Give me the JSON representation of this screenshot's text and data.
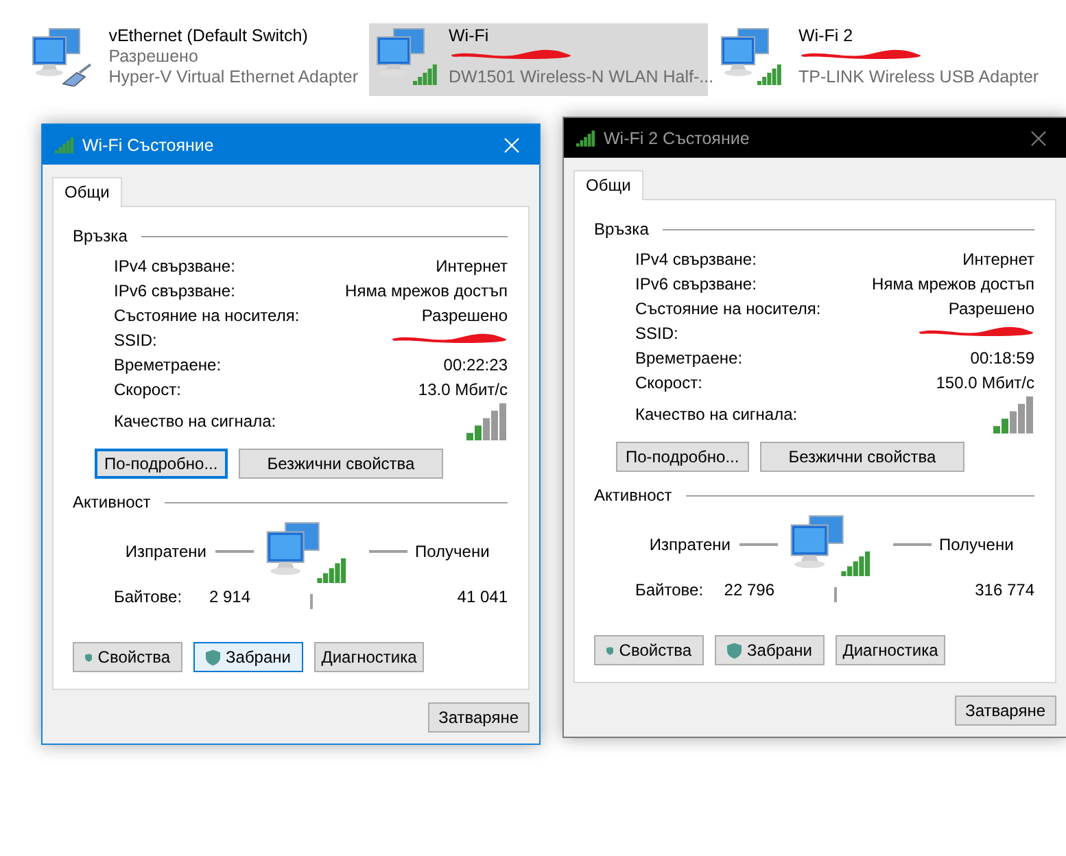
{
  "adapters": [
    {
      "kind": "ethernet",
      "name": "vEthernet (Default Switch)",
      "status": "Разрешено",
      "redacted": false,
      "device": "Hyper-V Virtual Ethernet Adapter",
      "selected": false
    },
    {
      "kind": "wireless",
      "name": "Wi-Fi",
      "redacted": true,
      "device": "DW1501 Wireless-N WLAN Half-...",
      "selected": true
    },
    {
      "kind": "wireless",
      "name": "Wi-Fi 2",
      "redacted": true,
      "device": "TP-LINK Wireless USB Adapter",
      "selected": false
    }
  ],
  "dialogs": [
    {
      "title": "Wi-Fi Състояние",
      "active": true,
      "tab": {
        "label": "Общи",
        "selected": true
      },
      "connection": {
        "heading": "Връзка",
        "rows": [
          {
            "label": "IPv4 свързване:",
            "value": "Интернет",
            "redacted": false
          },
          {
            "label": "IPv6 свързване:",
            "value": "Няма мрежов достъп",
            "redacted": false
          },
          {
            "label": "Състояние на носителя:",
            "value": "Разрешено",
            "redacted": false
          },
          {
            "label": "SSID:",
            "redacted": true
          },
          {
            "label": "Времетраене:",
            "value": "00:22:23",
            "redacted": false
          },
          {
            "label": "Скорост:",
            "value": "13.0 Мбит/с",
            "redacted": false
          }
        ],
        "signal_label": "Качество на сигнала:"
      },
      "connection_buttons": [
        {
          "label": "По-подробно...",
          "focused": true,
          "hovered": false,
          "shield": false
        },
        {
          "label": "Безжични свойства",
          "focused": false,
          "hovered": false,
          "shield": false
        }
      ],
      "activity": {
        "heading": "Активност",
        "sent": "Изпратени",
        "received": "Получени",
        "bytes_label": "Байтове:",
        "bytes_sent": "2 914",
        "bytes_received": "41 041"
      },
      "action_buttons": [
        {
          "label": "Свойства",
          "focused": false,
          "hovered": false,
          "shield": true
        },
        {
          "label": "Забрани",
          "focused": false,
          "hovered": true,
          "shield": true
        },
        {
          "label": "Диагностика",
          "focused": false,
          "hovered": false,
          "shield": false
        }
      ],
      "close_button": "Затваряне"
    },
    {
      "title": "Wi-Fi 2 Състояние",
      "active": false,
      "tab": {
        "label": "Общи",
        "selected": true
      },
      "connection": {
        "heading": "Връзка",
        "rows": [
          {
            "label": "IPv4 свързване:",
            "value": "Интернет",
            "redacted": false
          },
          {
            "label": "IPv6 свързване:",
            "value": "Няма мрежов достъп",
            "redacted": false
          },
          {
            "label": "Състояние на носителя:",
            "value": "Разрешено",
            "redacted": false
          },
          {
            "label": "SSID:",
            "redacted": true
          },
          {
            "label": "Времетраене:",
            "value": "00:18:59",
            "redacted": false
          },
          {
            "label": "Скорост:",
            "value": "150.0 Мбит/с",
            "redacted": false
          }
        ],
        "signal_label": "Качество на сигнала:"
      },
      "connection_buttons": [
        {
          "label": "По-подробно...",
          "focused": false,
          "hovered": false,
          "shield": false
        },
        {
          "label": "Безжични свойства",
          "focused": false,
          "hovered": false,
          "shield": false
        }
      ],
      "activity": {
        "heading": "Активност",
        "sent": "Изпратени",
        "received": "Получени",
        "bytes_label": "Байтове:",
        "bytes_sent": "22 796",
        "bytes_received": "316 774"
      },
      "action_buttons": [
        {
          "label": "Свойства",
          "focused": false,
          "hovered": false,
          "shield": true
        },
        {
          "label": "Забрани",
          "focused": false,
          "hovered": false,
          "shield": true
        },
        {
          "label": "Диагностика",
          "focused": false,
          "hovered": false,
          "shield": false
        }
      ],
      "close_button": "Затваряне"
    }
  ]
}
